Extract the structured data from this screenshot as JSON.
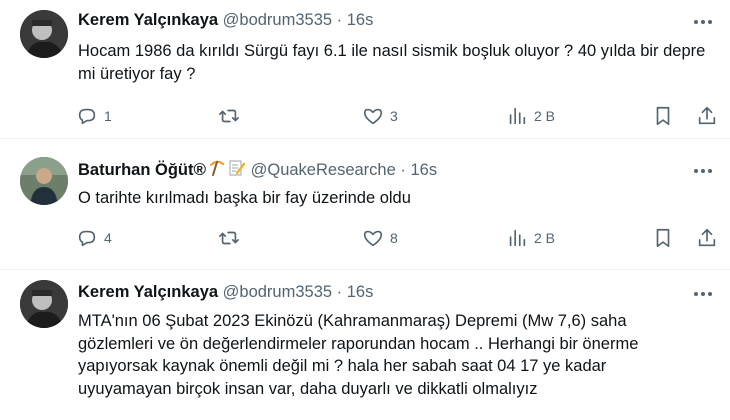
{
  "tweets": [
    {
      "name": "Kerem Yalçınkaya",
      "handle": "@bodrum3535",
      "dot": "·",
      "time": "16s",
      "text": "Hocam 1986 da kırıldı Sürgü fayı 6.1 ile nasıl sismik boşluk oluyor ? 40 yılda bir depre mi üretiyor fay ?",
      "replies": "1",
      "retweets": "",
      "likes": "3",
      "views": "2 B",
      "icons": [
        "reply-icon",
        "retweet-icon",
        "like-icon",
        "views-icon",
        "bookmark-icon",
        "share-icon"
      ]
    },
    {
      "name": "Baturhan Öğüt",
      "badge": "®",
      "handle": "@QuakeResearche",
      "dot": "·",
      "time": "16s",
      "text": "O tarihte kırılmadı başka bir fay üzerinde oldu",
      "replies": "4",
      "retweets": "",
      "likes": "8",
      "views": "2 B",
      "name_emojis": [
        "pick-emoji",
        "memo-emoji"
      ]
    },
    {
      "name": "Kerem Yalçınkaya",
      "handle": "@bodrum3535",
      "dot": "·",
      "time": "16s",
      "text": "MTA'nın 06 Şubat 2023 Ekinözü (Kahramanmaraş) Depremi (Mw 7,6) saha gözlemleri ve ön değerlendirmeler raporundan hocam .. Herhangi bir önerme yapıyorsak kaynak önemli değil mi ? hala her sabah saat 04 17 ye kadar uyuyamayan birçok insan var, daha duyarlı ve dikkatli olmalıyız"
    }
  ],
  "colors": {
    "text": "#0f1419",
    "secondary": "#536471",
    "divider": "#eff3f4"
  }
}
